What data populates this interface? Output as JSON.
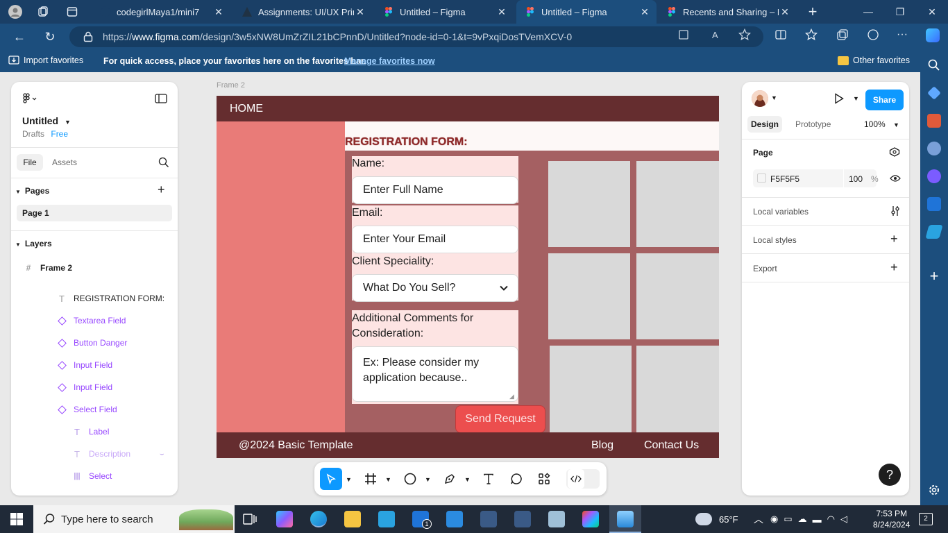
{
  "browser": {
    "tabs": [
      {
        "title": "codegirlMaya1/mini7"
      },
      {
        "title": "Assignments: UI/UX Princip"
      },
      {
        "title": "Untitled – Figma"
      },
      {
        "title": "Untitled – Figma"
      },
      {
        "title": "Recents and Sharing – Figm"
      }
    ],
    "new_tab": "+",
    "url": {
      "prefix": "https://",
      "host": "www.figma.com",
      "path": "/design/3w5xNW8UmZrZIL21bCPnnD/Untitled?node-id=0-1&t=9vPxqiDosTVemXCV-0"
    },
    "favorites": {
      "import_label": "Import favorites",
      "message": "For quick access, place your favorites here on the favorites bar.",
      "manage_link": "Manage favorites now",
      "other_label": "Other favorites"
    }
  },
  "figma": {
    "file_title": "Untitled",
    "location": "Drafts",
    "plan_badge": "Free",
    "tabs": {
      "file": "File",
      "assets": "Assets"
    },
    "pages_heading": "Pages",
    "pages": [
      "Page 1"
    ],
    "layers_heading": "Layers",
    "layers": [
      {
        "name": "Frame 2",
        "kind": "frame"
      },
      {
        "name": "REGISTRATION FORM:",
        "kind": "text"
      },
      {
        "name": "Textarea Field",
        "kind": "component"
      },
      {
        "name": "Button Danger",
        "kind": "component"
      },
      {
        "name": "Input Field",
        "kind": "component"
      },
      {
        "name": "Input Field",
        "kind": "component"
      },
      {
        "name": "Select Field",
        "kind": "component"
      },
      {
        "name": "Label",
        "kind": "text-child"
      },
      {
        "name": "Description",
        "kind": "text-child-hidden"
      },
      {
        "name": "Select",
        "kind": "child"
      }
    ],
    "right_panel": {
      "tabs": {
        "design": "Design",
        "prototype": "Prototype"
      },
      "zoom": "100%",
      "share_label": "Share",
      "page_section": "Page",
      "page_color": "F5F5F5",
      "page_opacity": "100",
      "percent_sign": "%",
      "local_variables": "Local variables",
      "local_styles": "Local styles",
      "export": "Export"
    },
    "frame": {
      "label": "Frame 2",
      "nav_home": "HOME",
      "form_title": "REGISTRATION FORM:",
      "name_label": "Name:",
      "name_placeholder": "Enter Full Name",
      "email_label": "Email:",
      "email_placeholder": "Enter Your Email",
      "speciality_label": "Client Speciality:",
      "speciality_value": "What Do You Sell?",
      "comments_label_1": "Additional Comments for",
      "comments_label_2": "Consideration:",
      "comments_placeholder": "Ex: Please consider my\napplication because..",
      "send_button": "Send Request",
      "footer_copyright": "@2024 Basic Template",
      "footer_blog": "Blog",
      "footer_contact": "Contact Us"
    },
    "help": "?"
  },
  "taskbar": {
    "search_placeholder": "Type here to search",
    "weather": "65°F",
    "time": "7:53 PM",
    "date": "8/24/2024",
    "notification_count": "2",
    "mail_badge": "1"
  },
  "colors": {
    "frame_bg": "#e97b78",
    "header_footer": "#652d2f",
    "form_panel": "#a56062",
    "danger_button": "#ec4e4e",
    "figma_blue": "#0d99ff"
  }
}
